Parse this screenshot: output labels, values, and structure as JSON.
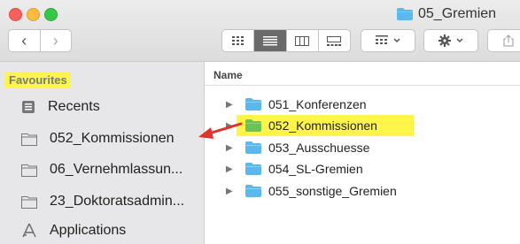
{
  "window": {
    "title": "05_Gremien"
  },
  "toolbar": {
    "back_icon": "‹",
    "forward_icon": "›"
  },
  "sidebar": {
    "header": "Favourites",
    "items": [
      {
        "label": "Recents",
        "icon": "recents-icon"
      },
      {
        "label": "052_Kommissionen",
        "icon": "folder-icon"
      },
      {
        "label": "06_Vernehmlassun...",
        "icon": "folder-icon"
      },
      {
        "label": "23_Doktoratsadmin...",
        "icon": "folder-icon"
      },
      {
        "label": "Applications",
        "icon": "applications-icon"
      }
    ]
  },
  "list": {
    "column_name": "Name",
    "rows": [
      {
        "name": "051_Konferenzen",
        "color": "#5ab8ec"
      },
      {
        "name": "052_Kommissionen",
        "color": "#6cc255"
      },
      {
        "name": "053_Ausschuesse",
        "color": "#5ab8ec"
      },
      {
        "name": "054_SL-Gremien",
        "color": "#5ab8ec"
      },
      {
        "name": "055_sonstige_Gremien",
        "color": "#5ab8ec"
      }
    ]
  },
  "colors": {
    "highlight": "#fef54a",
    "annotation_arrow": "#e0332e",
    "sidebar_bg": "#e7e6e8"
  }
}
